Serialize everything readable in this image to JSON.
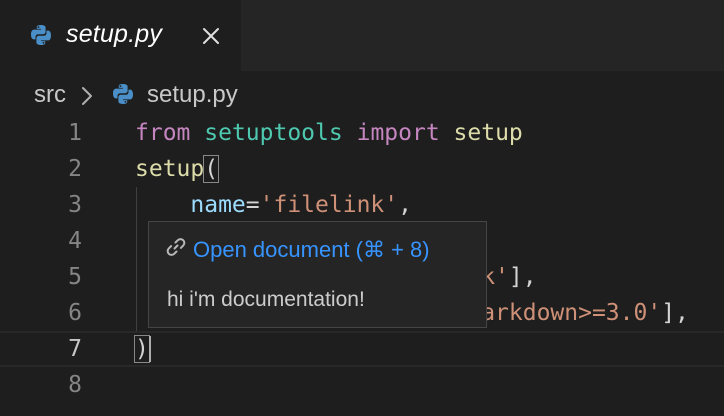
{
  "tab": {
    "title": "setup.py",
    "file_icon": "python-icon",
    "close_icon": "close-icon"
  },
  "breadcrumb": {
    "folder": "src",
    "separator_icon": "chevron-right-icon",
    "file": "setup.py"
  },
  "editor": {
    "line_numbers": [
      "1",
      "2",
      "3",
      "4",
      "5",
      "6",
      "7",
      "8"
    ],
    "current_line": "7",
    "lines": [
      {
        "tokens": [
          {
            "t": "from",
            "c": "kw"
          },
          {
            "t": " ",
            "c": "punc"
          },
          {
            "t": "setuptools",
            "c": "mod"
          },
          {
            "t": " ",
            "c": "punc"
          },
          {
            "t": "import",
            "c": "kw"
          },
          {
            "t": " ",
            "c": "punc"
          },
          {
            "t": "setup",
            "c": "fn"
          }
        ]
      },
      {
        "tokens": [
          {
            "t": "setup",
            "c": "fn"
          },
          {
            "t": "(",
            "c": "punc"
          }
        ]
      },
      {
        "tokens": [
          {
            "t": "    ",
            "c": "punc"
          },
          {
            "t": "name",
            "c": "var"
          },
          {
            "t": "=",
            "c": "punc"
          },
          {
            "t": "'filelink'",
            "c": "str"
          },
          {
            "t": ",",
            "c": "punc"
          }
        ]
      },
      {
        "tokens": []
      },
      {
        "tokens": [
          {
            "t": "                         ",
            "c": "punc"
          },
          {
            "t": "k'",
            "c": "str"
          },
          {
            "t": "],",
            "c": "punc"
          }
        ]
      },
      {
        "tokens": [
          {
            "t": "                         ",
            "c": "punc"
          },
          {
            "t": "arkdown>=3.0'",
            "c": "str"
          },
          {
            "t": "],",
            "c": "punc"
          }
        ]
      },
      {
        "tokens": [
          {
            "t": ")",
            "c": "punc"
          }
        ]
      },
      {
        "tokens": []
      }
    ]
  },
  "hover": {
    "link_icon": "link-icon",
    "link_label": "Open document (⌘ + 8)",
    "body": "hi i'm documentation!"
  },
  "colors": {
    "background": "#1e1e1e",
    "tabbar": "#252526",
    "link": "#3794ff",
    "keyword": "#c586c0",
    "module": "#4ec9b0",
    "function": "#dcdcaa",
    "variable": "#9cdcfe",
    "string": "#ce9178"
  }
}
